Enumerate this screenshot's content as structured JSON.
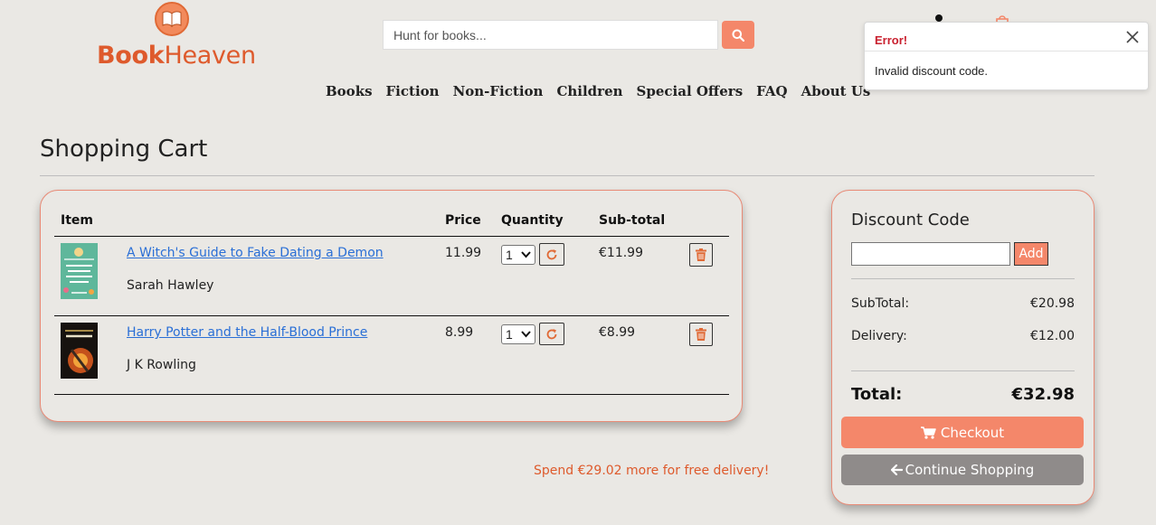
{
  "brand": {
    "part1": "Book",
    "part2": "Heaven",
    "color": "#de5a2c"
  },
  "search": {
    "placeholder": "Hunt for books..."
  },
  "nav": [
    "Books",
    "Fiction",
    "Non-Fiction",
    "Children",
    "Special Offers",
    "FAQ",
    "About Us"
  ],
  "toast": {
    "title": "Error!",
    "message": "Invalid discount code."
  },
  "page": {
    "title": "Shopping Cart"
  },
  "table": {
    "headers": {
      "item": "Item",
      "price": "Price",
      "quantity": "Quantity",
      "subtotal": "Sub-total"
    }
  },
  "cart_items": [
    {
      "title": "A Witch's Guide to Fake Dating a Demon",
      "author": "Sarah Hawley",
      "price": "11.99",
      "quantity": "1",
      "subtotal": "€11.99"
    },
    {
      "title": "Harry Potter and the Half-Blood Prince",
      "author": "J K Rowling",
      "price": "8.99",
      "quantity": "1",
      "subtotal": "€8.99"
    }
  ],
  "delivery_note": "Spend €29.02 more for free delivery!",
  "summary": {
    "title": "Discount Code",
    "add_label": "Add",
    "subtotal_label": "SubTotal:",
    "subtotal_value": "€20.98",
    "delivery_label": "Delivery:",
    "delivery_value": "€12.00",
    "total_label": "Total:",
    "total_value": "€32.98",
    "checkout_label": "Checkout",
    "continue_label": "Continue Shopping"
  },
  "colors": {
    "accent": "#f4876a",
    "border": "#e88a76",
    "error": "#c9202f",
    "link": "#2a6fd6",
    "secondary_button": "#8f8b8a"
  }
}
